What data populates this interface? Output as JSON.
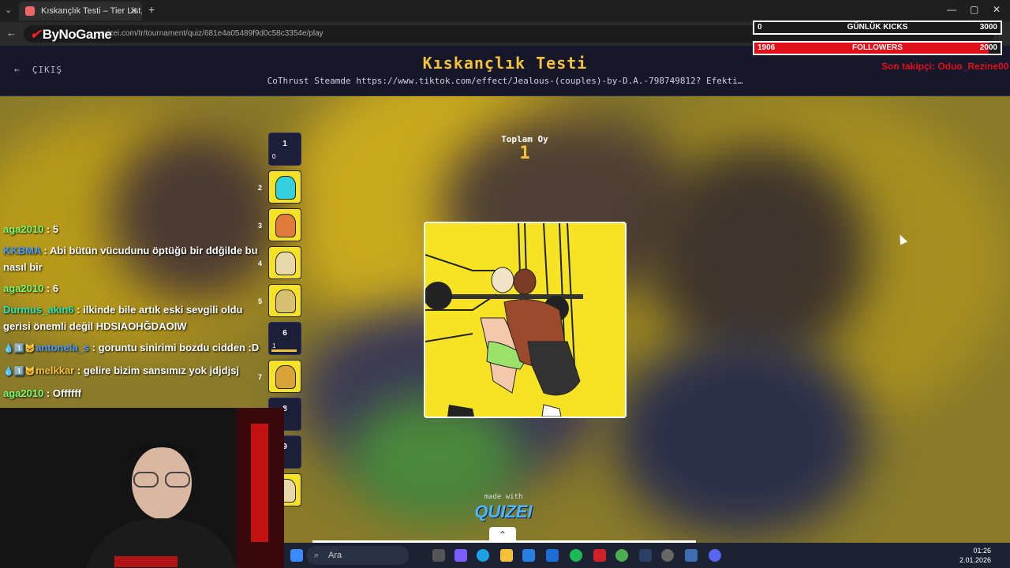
{
  "browser": {
    "tab_title": "Kıskançlık Testi – Tier List, Kör S",
    "url": "quizei.com/tr/tournament/quiz/681e4a05489f9d0c58c3354e/play"
  },
  "overlay": {
    "logo": "ByNoGame",
    "kicks": {
      "current": "0",
      "label": "GÜNLÜK KICKS",
      "goal": "3000"
    },
    "followers": {
      "current": "1906",
      "label": "FOLLOWERS",
      "goal": "2000",
      "progress": 0.953
    },
    "last_follower": "Son takipçi: Oduo_Rezine00"
  },
  "header": {
    "exit_label": "ÇIKIŞ",
    "title": "Kıskançlık Testi",
    "subtitle": "CoThrust Steamde https://www.tiktok.com/effect/Jealous-(couples)-by-D.A.-798749812? Efekti…"
  },
  "chat": [
    {
      "user": "aga2010",
      "color": "#7cfc6c",
      "text": ": 5",
      "badges": ""
    },
    {
      "user": "KKBMA",
      "color": "#4a9bff",
      "text": ": Abi bütün vücudunu öptüğü bir ddğilde bu nasıl bir",
      "badges": ""
    },
    {
      "user": "aga2010",
      "color": "#7cfc6c",
      "text": ": 6",
      "badges": ""
    },
    {
      "user": "Durmus_akin6",
      "color": "#2ee6b0",
      "text": ": ilkinde bile artık eski sevgili oldu gerisi önemli değil HDSIAOHĞDAOIW",
      "badges": ""
    },
    {
      "user": "antonela_s",
      "color": "#4a9bff",
      "text": ": goruntu sinirimi bozdu cidden :D",
      "badges": "💧1️⃣🐱"
    },
    {
      "user": "melkkar",
      "color": "#f5c23a",
      "text": ": gelire bizim sansımız yok jdjdjsj",
      "badges": "💧1️⃣🐱"
    },
    {
      "user": "aga2010",
      "color": "#7cfc6c",
      "text": ": Offffff",
      "badges": ""
    }
  ],
  "bracket": {
    "slots": [
      {
        "type": "dark",
        "num": "1",
        "count": "0"
      },
      {
        "type": "img",
        "side": "2"
      },
      {
        "type": "img",
        "side": "3"
      },
      {
        "type": "img",
        "side": "4"
      },
      {
        "type": "img",
        "side": "5"
      },
      {
        "type": "dark",
        "num": "6",
        "count": "1",
        "bar": 0.9
      },
      {
        "type": "img",
        "side": "7"
      },
      {
        "type": "dark",
        "num": "8"
      },
      {
        "type": "dark",
        "num": "9"
      },
      {
        "type": "img"
      }
    ]
  },
  "vote": {
    "label": "Toplam Oy",
    "count": "1"
  },
  "footer": {
    "made_with": "made with",
    "brand": "QUIZEI"
  },
  "taskbar": {
    "search": "Ara",
    "time": "01:26",
    "date": "2.01.2026"
  }
}
